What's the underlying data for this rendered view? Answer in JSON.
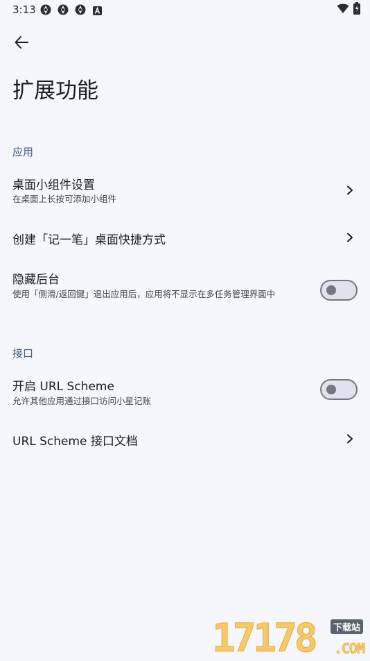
{
  "status_bar": {
    "time": "3:13",
    "notification_icons": [
      "app-notification-icon",
      "app-notification-icon",
      "app-notification-icon",
      "app-a-icon"
    ],
    "right_icons": [
      "wifi-icon",
      "battery-charging-icon"
    ]
  },
  "header": {
    "back_icon": "arrow-back-icon",
    "title": "扩展功能"
  },
  "sections": [
    {
      "header": "应用",
      "items": [
        {
          "title": "桌面小组件设置",
          "subtitle": "在桌面上长按可添加小组件",
          "control": "chevron"
        },
        {
          "title": "创建「记一笔」桌面快捷方式",
          "control": "chevron"
        },
        {
          "title": "隐藏后台",
          "subtitle": "使用「侧滑/返回键」退出应用后，应用将不显示在多任务管理界面中",
          "control": "switch",
          "checked": false
        }
      ]
    },
    {
      "header": "接口",
      "items": [
        {
          "title": "开启 URL Scheme",
          "subtitle": "允许其他应用通过接口访问小星记账",
          "control": "switch",
          "checked": false
        },
        {
          "title": "URL Scheme 接口文档",
          "control": "chevron"
        }
      ]
    }
  ],
  "watermark": {
    "digits": "17178",
    "badge": "下载站",
    "domain": ".COM"
  },
  "colors": {
    "background": "#f6f7fc",
    "section_header": "#3f5f93",
    "text_primary": "#1b1c20",
    "text_secondary": "#45474e",
    "switch_outline": "#74777f"
  }
}
